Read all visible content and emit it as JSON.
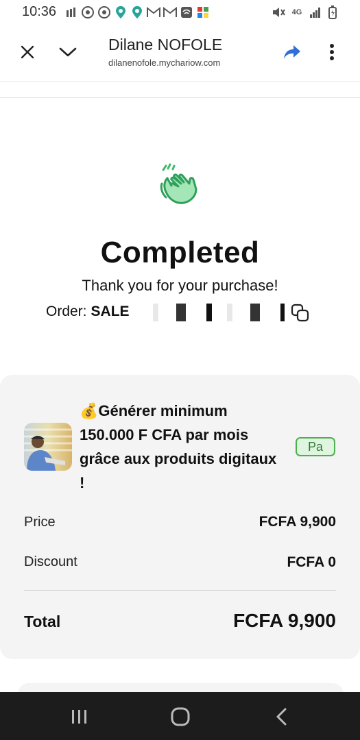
{
  "status_bar": {
    "time": "10:36",
    "network": "4G"
  },
  "header": {
    "title": "Dilane NOFOLE",
    "subtitle": "dilanenofole.mychariow.com"
  },
  "completed": {
    "title": "Completed",
    "message": "Thank you for your purchase!",
    "order_label": "Order:",
    "order_id_visible": "SALE"
  },
  "summary": {
    "product_name": "💰Générer minimum 150.000 F CFA par mois grâce aux produits digitaux !",
    "badge": "Pa",
    "price_label": "Price",
    "price_value": "FCFA 9,900",
    "discount_label": "Discount",
    "discount_value": "FCFA 0",
    "total_label": "Total",
    "total_value": "FCFA 9,900"
  },
  "colors": {
    "accent_green": "#4caf50",
    "share_blue": "#2f6fd6",
    "nav_bg": "#1c1c1c"
  }
}
